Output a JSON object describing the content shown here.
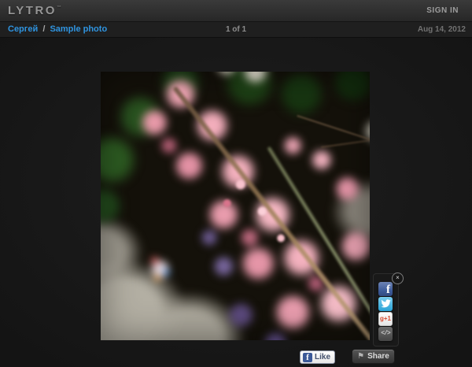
{
  "header": {
    "logo": "LYTRO",
    "trademark": "™",
    "sign_in": "SIGN IN"
  },
  "breadcrumb": {
    "user": "Сергей",
    "separator": "/",
    "photo_title": "Sample photo"
  },
  "toolbar": {
    "pagination": "1 of 1",
    "date": "Aug 14, 2012"
  },
  "photo": {
    "description": "Close-up light-field photograph of a pink lupine flower spike with green leaves, purple buds, white blossoms and a pale cloth background"
  },
  "share_panel": {
    "close_glyph": "×",
    "facebook": {
      "label": "Share on Facebook",
      "glyph": "f",
      "color": "#3b5998"
    },
    "twitter": {
      "label": "Share on Twitter",
      "color": "#2aa3d6"
    },
    "google_plus_one": {
      "label": "Google +1",
      "glyph": "g+1",
      "color": "#d6492f"
    },
    "embed": {
      "label": "Embed code",
      "glyph": "</>",
      "color": "#5a5a5a"
    }
  },
  "actions": {
    "like": "Like",
    "share": "Share",
    "facebook_glyph": "f",
    "share_flag_glyph": "⚑"
  },
  "colors": {
    "accent_blue": "#2f94e0",
    "page_background": "#151515",
    "header_gradient_top": "#3a3a3a",
    "header_gradient_bottom": "#272727"
  }
}
